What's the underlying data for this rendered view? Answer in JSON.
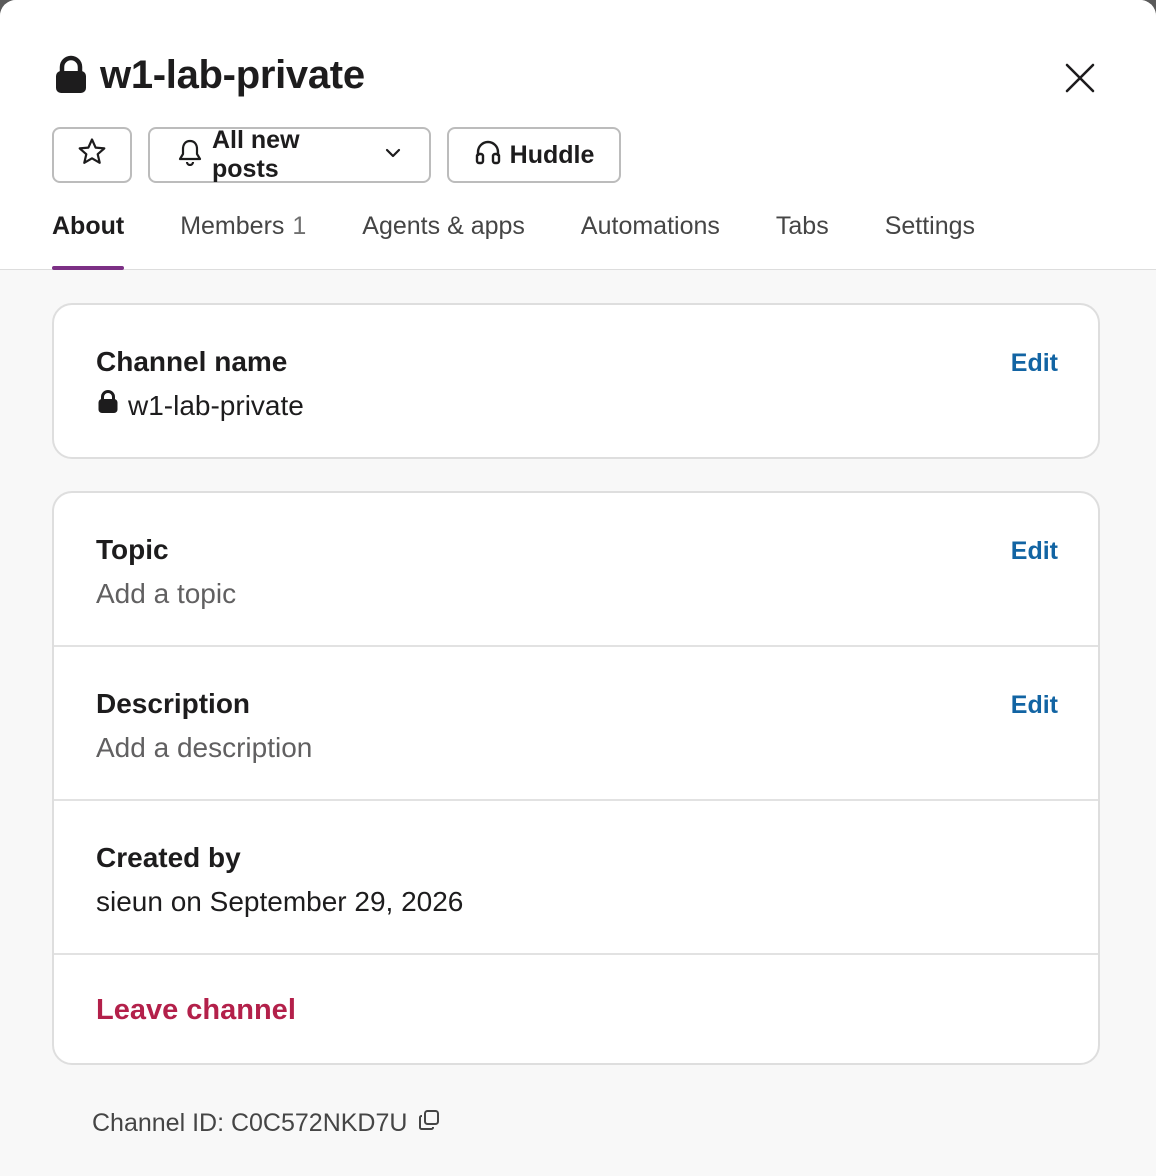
{
  "channel": {
    "title": "w1-lab-private"
  },
  "toolbar": {
    "notifications_label": "All new posts",
    "huddle_label": "Huddle"
  },
  "tabs": [
    {
      "label": "About",
      "active": true
    },
    {
      "label": "Members",
      "count": "1"
    },
    {
      "label": "Agents & apps"
    },
    {
      "label": "Automations"
    },
    {
      "label": "Tabs"
    },
    {
      "label": "Settings"
    }
  ],
  "name_section": {
    "label": "Channel name",
    "value": "w1-lab-private",
    "edit_label": "Edit"
  },
  "topic_section": {
    "label": "Topic",
    "value": "Add a topic",
    "edit_label": "Edit"
  },
  "description_section": {
    "label": "Description",
    "value": "Add a description",
    "edit_label": "Edit"
  },
  "created_section": {
    "label": "Created by",
    "value": "sieun on September 29, 2026"
  },
  "leave_label": "Leave channel",
  "channel_id_text": "Channel ID: C0C572NKD7U",
  "colors": {
    "accent": "#7c3085",
    "link": "#1264a3",
    "danger": "#b3204a"
  },
  "icons": [
    "lock-icon",
    "close-icon",
    "star-icon",
    "bell-icon",
    "chevron-down-icon",
    "headphones-icon",
    "copy-icon"
  ]
}
